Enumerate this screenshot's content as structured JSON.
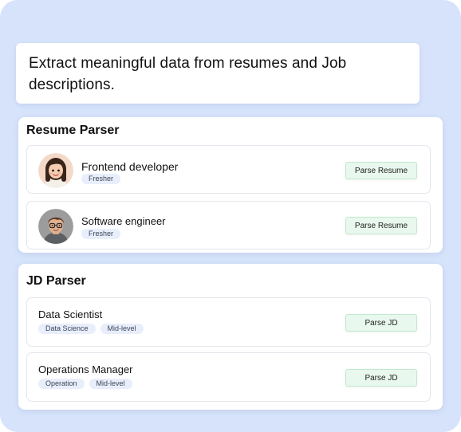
{
  "headline": "Extract meaningful data from resumes and Job descriptions.",
  "resume_parser": {
    "title": "Resume Parser",
    "items": [
      {
        "role": "Frontend developer",
        "tags": [
          "Fresher"
        ],
        "action": "Parse Resume",
        "avatar": "woman-avatar-icon"
      },
      {
        "role": "Software engineer",
        "tags": [
          "Fresher"
        ],
        "action": "Parse Resume",
        "avatar": "man-avatar-icon"
      }
    ]
  },
  "jd_parser": {
    "title": "JD Parser",
    "items": [
      {
        "role": "Data Scientist",
        "tags": [
          "Data Science",
          "Mid-level"
        ],
        "action": "Parse JD"
      },
      {
        "role": "Operations Manager",
        "tags": [
          "Operation",
          "Mid-level"
        ],
        "action": "Parse JD"
      }
    ]
  },
  "colors": {
    "background": "#d6e3fb",
    "tag_bg": "#e8eefb",
    "button_bg": "#e9f8ee",
    "button_border": "#bfe9cc"
  }
}
